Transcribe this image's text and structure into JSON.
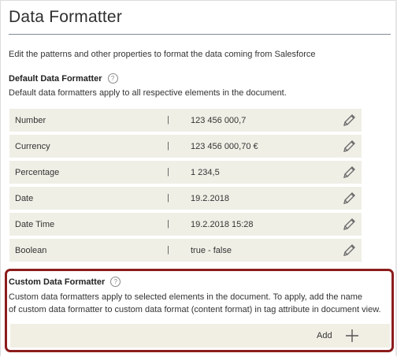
{
  "header": {
    "title": "Data Formatter"
  },
  "intro": "Edit the patterns and other properties to format the data coming from Salesforce",
  "default_section": {
    "title": "Default Data Formatter",
    "description": "Default data formatters apply to all respective elements in the document.",
    "help_glyph": "?",
    "separator": "|",
    "rows": [
      {
        "name": "Number",
        "value": "123 456 000,7"
      },
      {
        "name": "Currency",
        "value": "123 456 000,70 €"
      },
      {
        "name": "Percentage",
        "value": "1 234,5"
      },
      {
        "name": "Date",
        "value": "19.2.2018"
      },
      {
        "name": "Date Time",
        "value": "19.2.2018 15:28"
      },
      {
        "name": "Boolean",
        "value": "true - false"
      }
    ]
  },
  "custom_section": {
    "title": "Custom Data Formatter",
    "help_glyph": "?",
    "description_line1": "Custom data formatters apply to selected elements in the document. To apply, add the name",
    "description_line2": "of custom data formatter to custom data format (content format) in tag attribute in document view.",
    "add_label": "Add"
  },
  "colors": {
    "row_background": "#f0efe6",
    "highlight_border": "#8c1c1c",
    "title_rule": "#7f8a96"
  },
  "icons": {
    "edit": "pencil-icon",
    "add": "plus-icon",
    "help": "help-icon"
  }
}
